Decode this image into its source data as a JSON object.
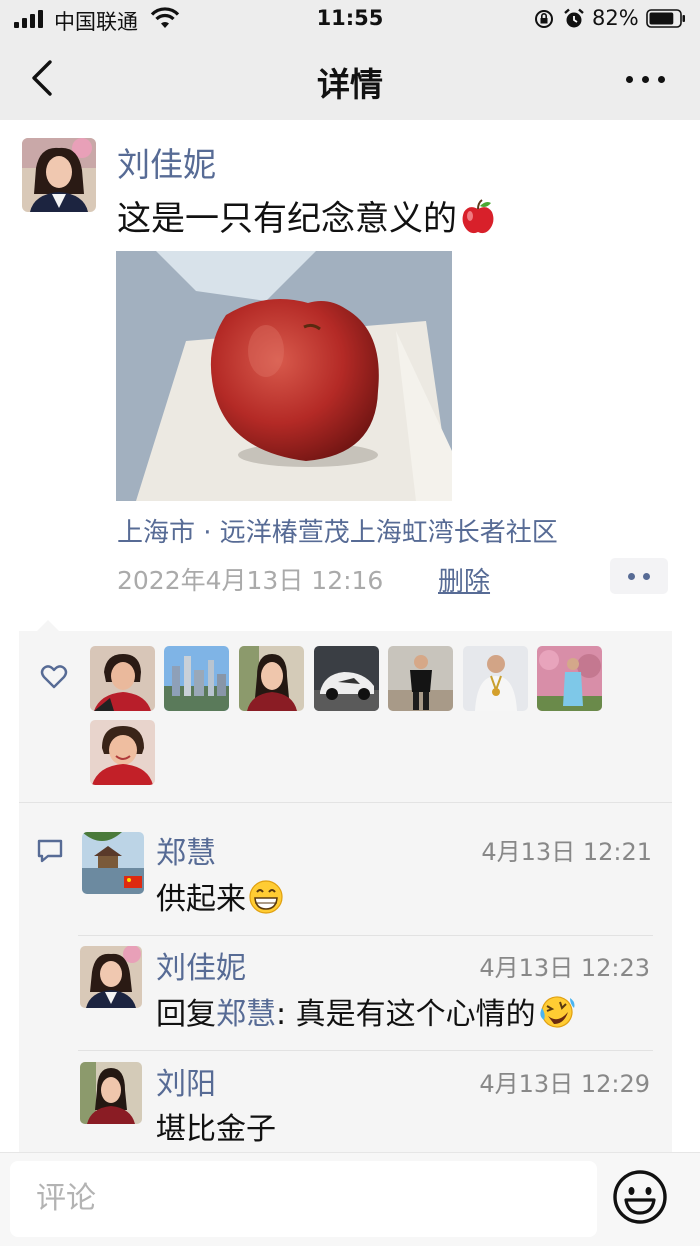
{
  "status_bar": {
    "carrier": "中国联通",
    "time": "11:55",
    "battery": "82%",
    "battery_level": 0.82
  },
  "nav": {
    "title": "详情",
    "back_icon": "chevron-left-icon",
    "more_icon": "more-icon"
  },
  "post": {
    "author": "刘佳妮",
    "text": "这是一只有纪念意义的",
    "emoji": "red-apple-emoji",
    "location": "上海市 · 远洋椿萱茂上海虹湾长者社区",
    "time": "2022年4月13日 12:16",
    "delete_label": "删除"
  },
  "likes": {
    "icon": "heart-icon",
    "avatars": [
      "avatar-woman-red",
      "avatar-city-skyline",
      "avatar-woman-2",
      "avatar-sports-car",
      "avatar-man-black",
      "avatar-man-medal",
      "avatar-blossom-woman",
      "avatar-woman-red-2"
    ]
  },
  "comments": [
    {
      "name": "郑慧",
      "time": "4月13日 12:21",
      "text": "供起来",
      "emoji": "grinning-emoji"
    },
    {
      "name": "刘佳妮",
      "time": "4月13日 12:23",
      "reply_prefix": "回复",
      "reply_to": "郑慧",
      "text": ": 真是有这个心情的",
      "emoji": "laughing-crying-emoji"
    },
    {
      "name": "刘阳",
      "time": "4月13日 12:29",
      "text": "堪比金子"
    }
  ],
  "input": {
    "placeholder": "评论",
    "emoji_icon": "smiley-icon"
  }
}
